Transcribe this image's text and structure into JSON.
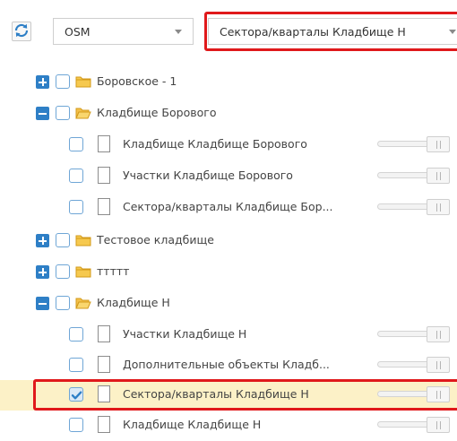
{
  "toolbar": {
    "basemap_select": {
      "value": "OSM"
    },
    "layer_select": {
      "value": "Сектора/кварталы Кладбище Н"
    }
  },
  "tree": {
    "rows": [
      {
        "type": "folder",
        "label": "Боровское - 1",
        "expanded": false,
        "checked": false
      },
      {
        "type": "folder",
        "label": "Кладбище Борового",
        "expanded": true,
        "checked": false
      },
      {
        "type": "layer",
        "label": "Кладбище Кладбище Борового",
        "checked": false,
        "opacity": 1
      },
      {
        "type": "layer",
        "label": "Участки Кладбище Борового",
        "checked": false,
        "opacity": 1
      },
      {
        "type": "layer",
        "label": "Сектора/кварталы Кладбище Бор...",
        "checked": false,
        "opacity": 1
      },
      {
        "type": "folder",
        "label": "Тестовое кладбище",
        "expanded": false,
        "checked": false
      },
      {
        "type": "folder",
        "label": "ттттт",
        "expanded": false,
        "checked": false
      },
      {
        "type": "folder",
        "label": "Кладбище Н",
        "expanded": true,
        "checked": false
      },
      {
        "type": "layer",
        "label": "Участки Кладбище Н",
        "checked": false,
        "opacity": 1
      },
      {
        "type": "layer",
        "label": "Дополнительные объекты Кладб...",
        "checked": false,
        "opacity": 1
      },
      {
        "type": "layer",
        "label": "Сектора/кварталы Кладбище Н",
        "checked": true,
        "opacity": 1,
        "highlighted": true
      },
      {
        "type": "layer",
        "label": "Кладбище Кладбище Н",
        "checked": false,
        "opacity": 1
      }
    ]
  },
  "colors": {
    "accent": "#2e7fc6",
    "highlight_row": "#fcf1c7",
    "annotation_red": "#e0191b",
    "folder_yellow": "#e8b32b"
  }
}
